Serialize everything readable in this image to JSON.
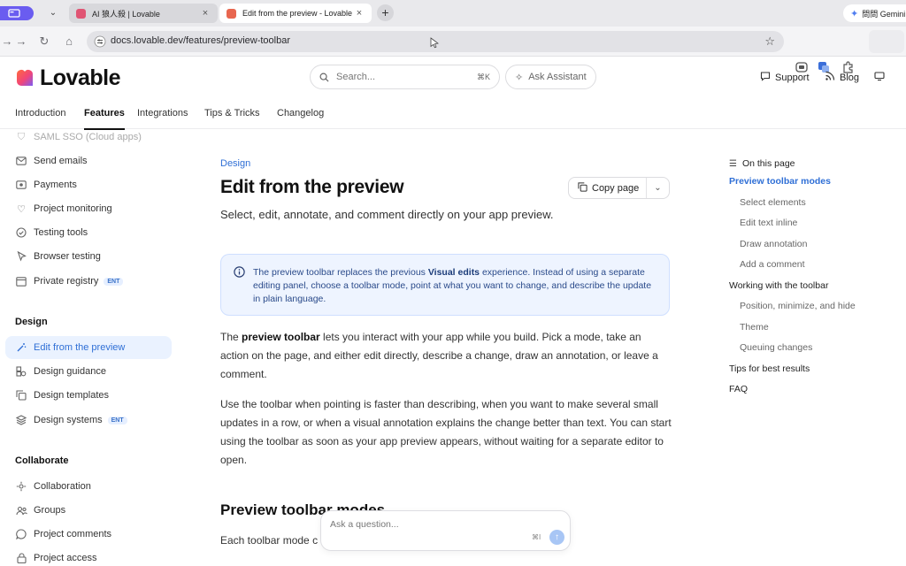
{
  "browser": {
    "tabs": [
      {
        "title": "AI 狼人殺 | Lovable",
        "favicon_color": "#e05574"
      },
      {
        "title": "Edit from the preview - Lovable",
        "favicon_color": "#e8664f"
      }
    ],
    "gemini_label": "問問 Gemini",
    "url": "docs.lovable.dev/features/preview-toolbar"
  },
  "header": {
    "logo_text": "Lovable",
    "search_placeholder": "Search...",
    "search_shortcut": "⌘K",
    "ask_assistant_label": "Ask Assistant",
    "support_label": "Support",
    "blog_label": "Blog"
  },
  "nav_tabs": [
    "Introduction",
    "Features",
    "Integrations",
    "Tips & Tricks",
    "Changelog"
  ],
  "active_nav_tab": "Features",
  "sidebar": {
    "items_top": [
      {
        "label": "SAML SSO (Cloud apps)",
        "icon": "shield-icon"
      },
      {
        "label": "Send emails",
        "icon": "mail-icon"
      },
      {
        "label": "Payments",
        "icon": "payments-icon"
      },
      {
        "label": "Project monitoring",
        "icon": "heart-pulse-icon"
      },
      {
        "label": "Testing tools",
        "icon": "check-circle-icon"
      },
      {
        "label": "Browser testing",
        "icon": "pointer-icon"
      },
      {
        "label": "Private registry",
        "icon": "registry-icon",
        "badge": "ENT"
      }
    ],
    "design_heading": "Design",
    "design_items": [
      {
        "label": "Edit from the preview",
        "icon": "wand-icon"
      },
      {
        "label": "Design guidance",
        "icon": "shapes-icon"
      },
      {
        "label": "Design templates",
        "icon": "copy-icon"
      },
      {
        "label": "Design systems",
        "icon": "layers-icon",
        "badge": "ENT"
      }
    ],
    "collab_heading": "Collaborate",
    "collab_items": [
      {
        "label": "Collaboration",
        "icon": "collaboration-icon"
      },
      {
        "label": "Groups",
        "icon": "groups-icon"
      },
      {
        "label": "Project comments",
        "icon": "comment-icon"
      },
      {
        "label": "Project access",
        "icon": "lock-icon"
      }
    ]
  },
  "main": {
    "eyebrow": "Design",
    "title": "Edit from the preview",
    "lead": "Select, edit, annotate, and comment directly on your app preview.",
    "copy_page_label": "Copy page",
    "callout": {
      "before": "The preview toolbar replaces the previous ",
      "bold": "Visual edits",
      "after": " experience. Instead of using a separate editing panel, choose a toolbar mode, point at what you want to change, and describe the update in plain language."
    },
    "p1": {
      "before": "The ",
      "bold": "preview toolbar",
      "after": " lets you interact with your app while you build. Pick a mode, take an action on the page, and either edit directly, describe a change, draw an annotation, or leave a comment."
    },
    "p2": "Use the toolbar when pointing is faster than describing, when you want to make several small updates in a row, or when a visual annotation explains the change better than text. You can start using the toolbar as soon as your app preview appears, without waiting for a separate editor to open.",
    "h2": "Preview toolbar modes",
    "p3_visible": "Each toolbar mode c"
  },
  "ask_box": {
    "placeholder": "Ask a question...",
    "shortcut": "⌘I"
  },
  "toc": {
    "heading": "On this page",
    "items": [
      {
        "label": "Preview toolbar modes",
        "level": 1,
        "active": true
      },
      {
        "label": "Select elements",
        "level": 2
      },
      {
        "label": "Edit text inline",
        "level": 2
      },
      {
        "label": "Draw annotation",
        "level": 2
      },
      {
        "label": "Add a comment",
        "level": 2
      },
      {
        "label": "Working with the toolbar",
        "level": 1
      },
      {
        "label": "Position, minimize, and hide",
        "level": 2
      },
      {
        "label": "Theme",
        "level": 2
      },
      {
        "label": "Queuing changes",
        "level": 2
      },
      {
        "label": "Tips for best results",
        "level": 1
      },
      {
        "label": "FAQ",
        "level": 1
      }
    ]
  },
  "colors": {
    "accent": "#2f6fd6",
    "callout_bg": "#eef4ff",
    "tab_group": "#6a5cf0"
  }
}
